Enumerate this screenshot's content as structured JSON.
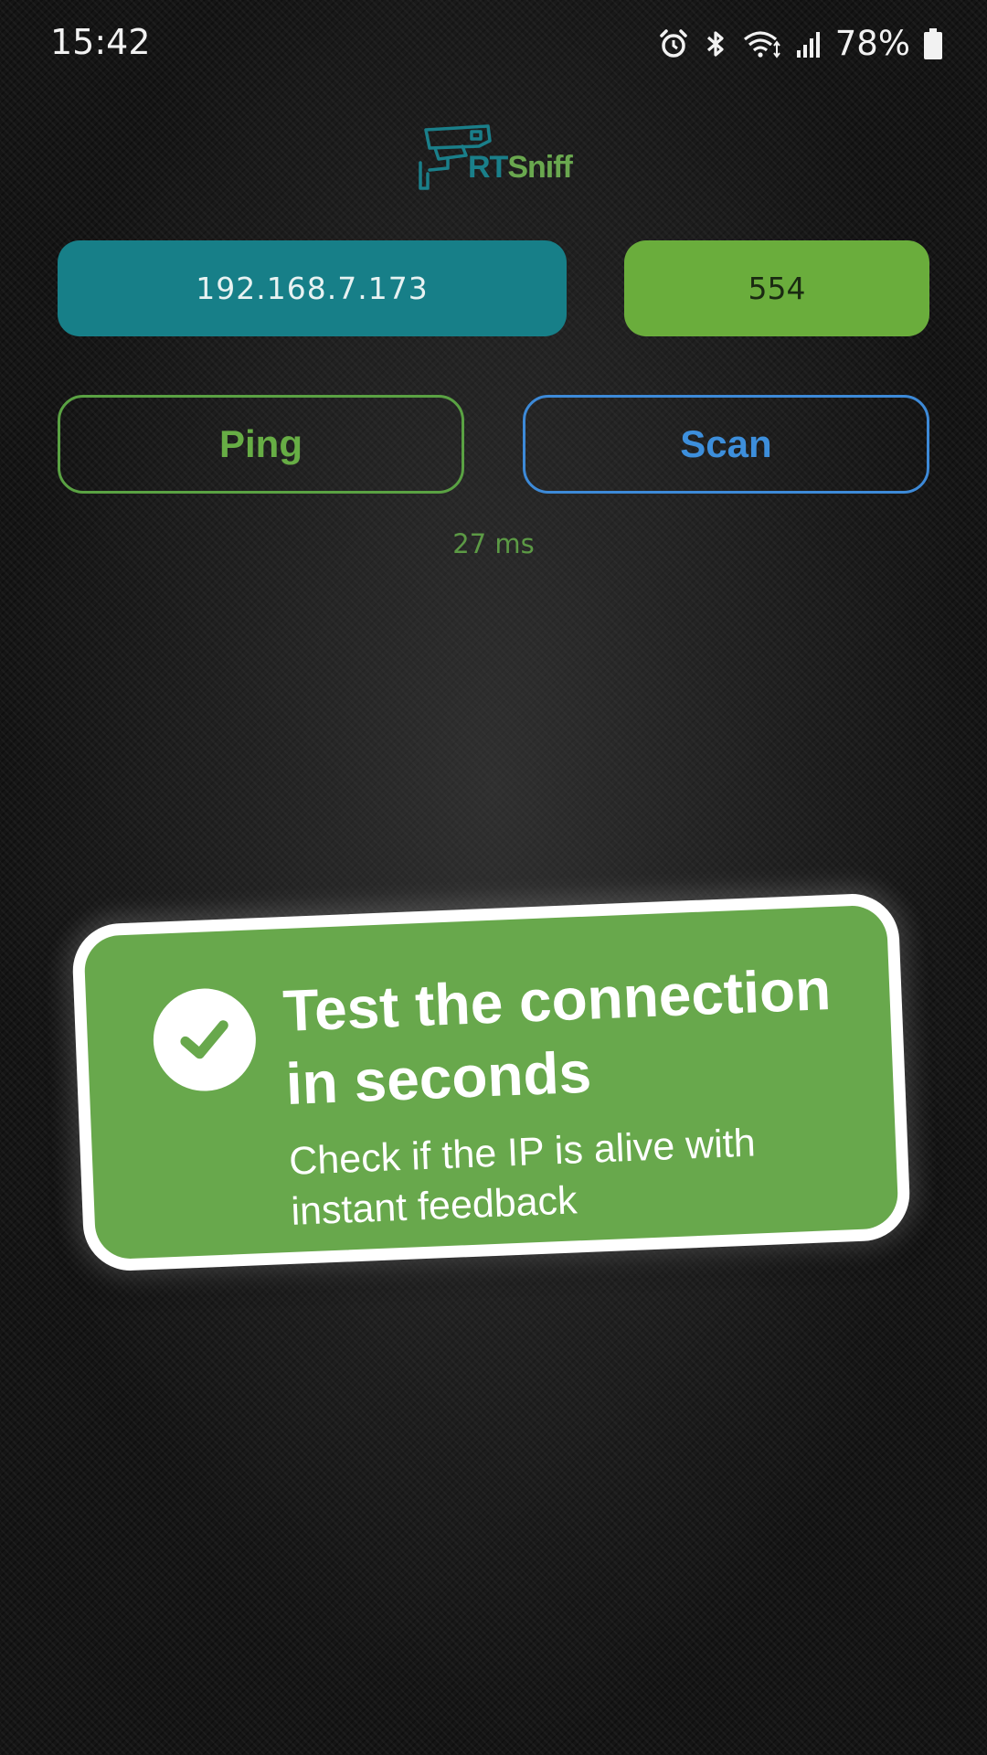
{
  "status_bar": {
    "time": "15:42",
    "battery": "78%",
    "icons": [
      "alarm-icon",
      "bluetooth-icon",
      "wifi-icon",
      "signal-icon",
      "battery-icon"
    ]
  },
  "logo": {
    "prefix": "RT",
    "suffix": "Sniff",
    "icon": "security-camera-icon"
  },
  "connection": {
    "ip_value": "192.168.7.173",
    "port_value": "554"
  },
  "actions": {
    "ping_label": "Ping",
    "scan_label": "Scan"
  },
  "result": {
    "ping_time": "27 ms"
  },
  "promo": {
    "title": "Test the connection in seconds",
    "subtitle": "Check if the IP is alive with instant feedback",
    "icon": "check-circle-icon"
  },
  "colors": {
    "ip_field": "#177f88",
    "port_field": "#6aad3c",
    "ping_accent": "#67ad45",
    "scan_accent": "#3d8fdc",
    "promo_bg": "#68a84c"
  }
}
